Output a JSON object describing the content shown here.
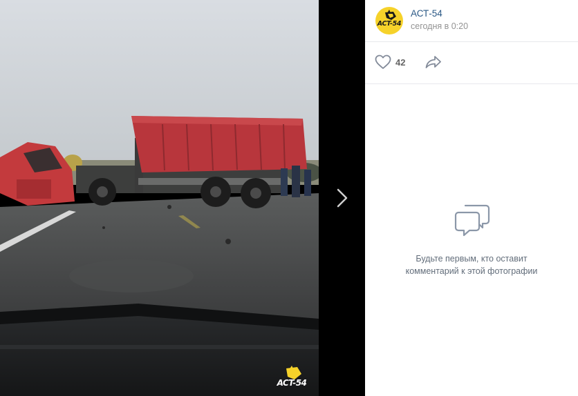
{
  "photo": {
    "watermark": "ACT-54"
  },
  "post": {
    "avatar_logo": "ACT-54",
    "group_name": "АСТ-54",
    "time": "сегодня в 0:20",
    "likes": "42"
  },
  "comments": {
    "empty_line1": "Будьте первым, кто оставит",
    "empty_line2": "комментарий к этой фотографии"
  },
  "icons": {
    "like": "heart-icon",
    "share": "share-arrow-icon",
    "next": "chevron-right-icon",
    "empty": "chat-bubbles-icon"
  },
  "colors": {
    "link": "#2a5885",
    "muted": "#939393",
    "avatar_bg": "#f6d22a",
    "divider": "#e7e8ec"
  }
}
